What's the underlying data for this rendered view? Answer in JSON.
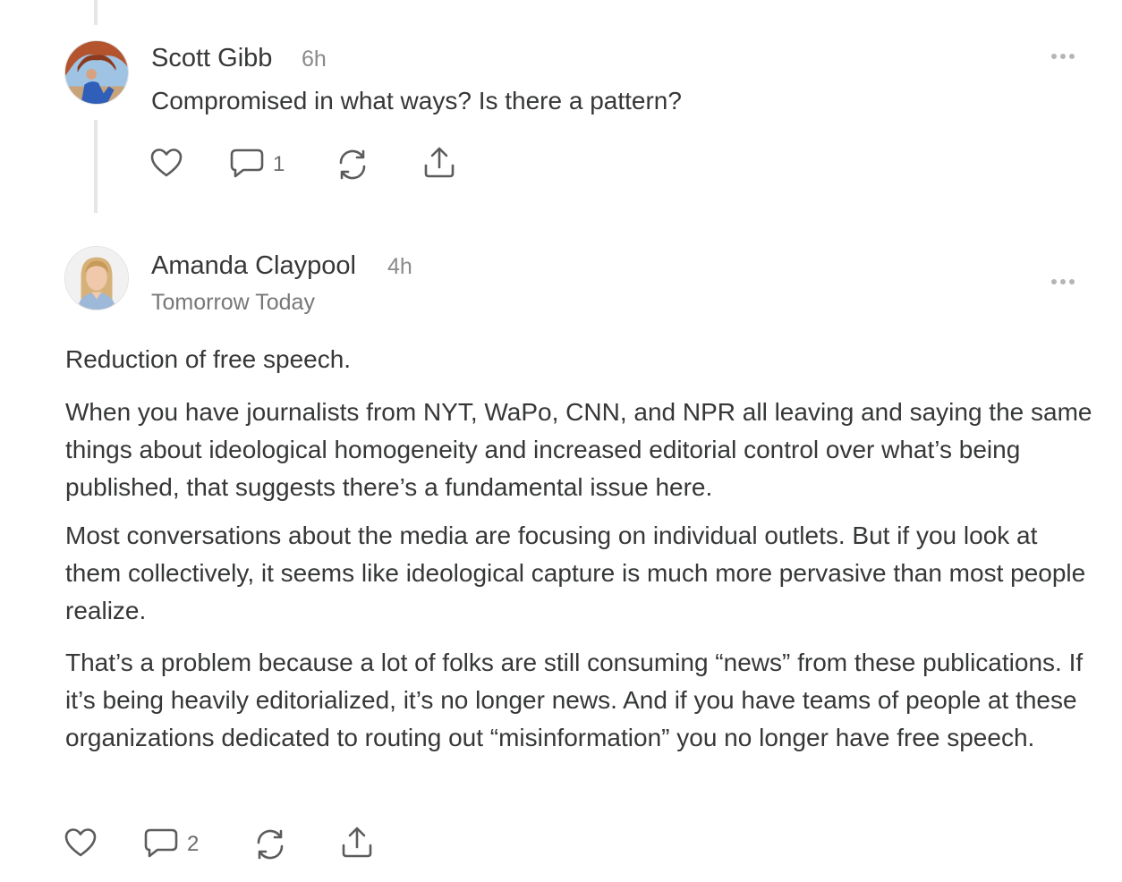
{
  "comments": [
    {
      "author": "Scott Gibb",
      "time": "6h",
      "text": "Compromised in what ways? Is there a pattern?",
      "reply_count": "1"
    },
    {
      "author": "Amanda Claypool",
      "time": "4h",
      "publication": "Tomorrow Today",
      "paragraphs": [
        "Reduction of free speech.",
        "When you have journalists from NYT, WaPo, CNN, and NPR all leaving and saying the same things about ideological homogeneity and increased editorial control over what’s being published, that suggests there’s a fundamental issue here.",
        "Most conversations about the media are focusing on individual outlets. But if you look at them collectively, it seems like ideological capture is much more pervasive than most people realize.",
        "That’s a problem because a lot of folks are still consuming “news” from these publications. If it’s being heavily editorialized, it’s no longer news. And if you have teams of people at these organizations dedicated to routing out “misinformation” you no longer have free speech."
      ],
      "reply_count": "2"
    }
  ],
  "icons": {
    "like": "heart-icon",
    "reply": "speech-bubble-icon",
    "restack": "restack-arrows-icon",
    "share": "share-upload-icon",
    "more": "ellipsis-icon"
  },
  "colors": {
    "text": "#363737",
    "muted": "#8a8a8a",
    "thread_line": "#e6e6e6",
    "icon": "#5c5c5c"
  }
}
